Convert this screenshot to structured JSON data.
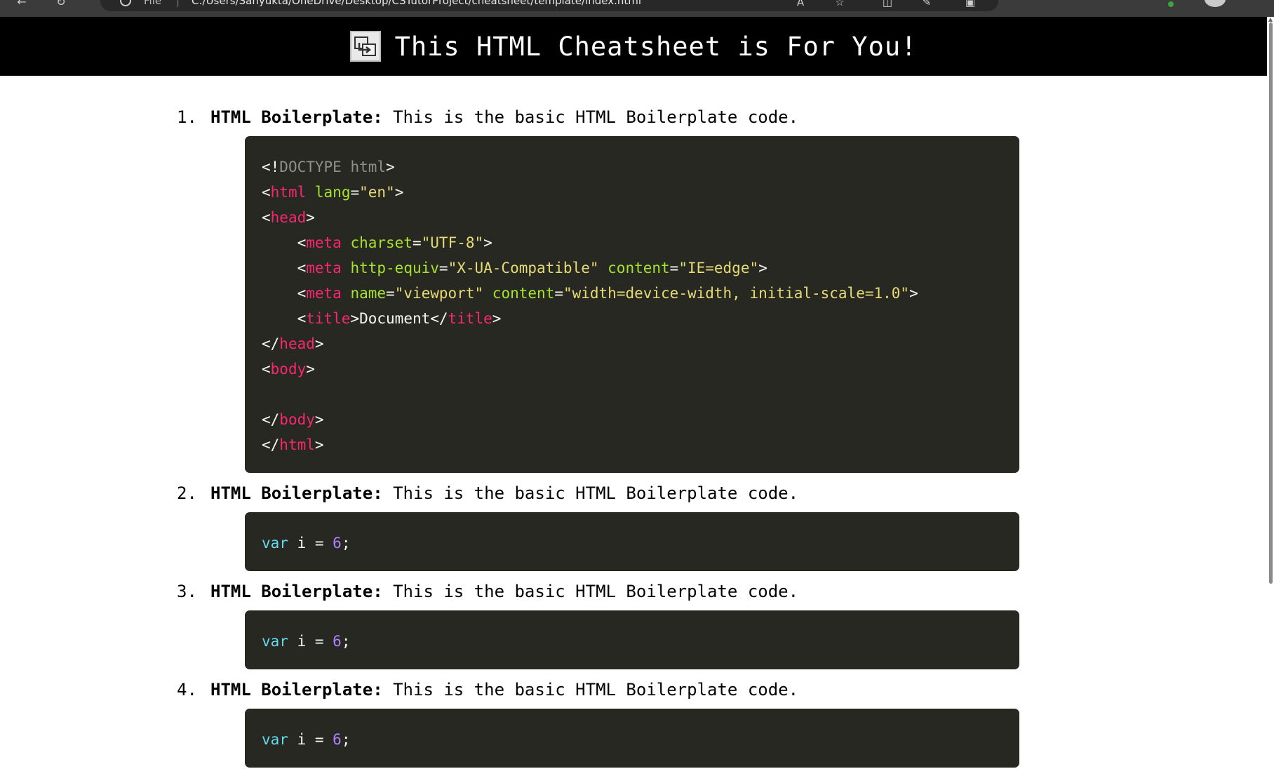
{
  "browser": {
    "url_scheme": "File",
    "url": "C:/Users/Sanyukta/OneDrive/Desktop/CSTutorProject/cheatsheet/template/index.html"
  },
  "header": {
    "title": "This HTML Cheatsheet is For You!",
    "background": "#000000",
    "text_color": "#ffffff"
  },
  "items": [
    {
      "number": "1.",
      "term": "HTML Boilerplate:",
      "description": " This is the basic HTML Boilerplate code.",
      "code_lines": [
        [
          {
            "t": "punc",
            "v": "<!"
          },
          {
            "t": "doctype",
            "v": "DOCTYPE html"
          },
          {
            "t": "punc",
            "v": ">"
          }
        ],
        [
          {
            "t": "punc",
            "v": "<"
          },
          {
            "t": "tag",
            "v": "html"
          },
          {
            "t": "text",
            "v": " "
          },
          {
            "t": "attr",
            "v": "lang"
          },
          {
            "t": "punc",
            "v": "="
          },
          {
            "t": "str",
            "v": "\"en\""
          },
          {
            "t": "punc",
            "v": ">"
          }
        ],
        [
          {
            "t": "punc",
            "v": "<"
          },
          {
            "t": "tag",
            "v": "head"
          },
          {
            "t": "punc",
            "v": ">"
          }
        ],
        [
          {
            "t": "text",
            "v": "    "
          },
          {
            "t": "punc",
            "v": "<"
          },
          {
            "t": "tag",
            "v": "meta"
          },
          {
            "t": "text",
            "v": " "
          },
          {
            "t": "attr",
            "v": "charset"
          },
          {
            "t": "punc",
            "v": "="
          },
          {
            "t": "str",
            "v": "\"UTF-8\""
          },
          {
            "t": "punc",
            "v": ">"
          }
        ],
        [
          {
            "t": "text",
            "v": "    "
          },
          {
            "t": "punc",
            "v": "<"
          },
          {
            "t": "tag",
            "v": "meta"
          },
          {
            "t": "text",
            "v": " "
          },
          {
            "t": "attr",
            "v": "http-equiv"
          },
          {
            "t": "punc",
            "v": "="
          },
          {
            "t": "str",
            "v": "\"X-UA-Compatible\""
          },
          {
            "t": "text",
            "v": " "
          },
          {
            "t": "attr",
            "v": "content"
          },
          {
            "t": "punc",
            "v": "="
          },
          {
            "t": "str",
            "v": "\"IE=edge\""
          },
          {
            "t": "punc",
            "v": ">"
          }
        ],
        [
          {
            "t": "text",
            "v": "    "
          },
          {
            "t": "punc",
            "v": "<"
          },
          {
            "t": "tag",
            "v": "meta"
          },
          {
            "t": "text",
            "v": " "
          },
          {
            "t": "attr",
            "v": "name"
          },
          {
            "t": "punc",
            "v": "="
          },
          {
            "t": "str",
            "v": "\"viewport\""
          },
          {
            "t": "text",
            "v": " "
          },
          {
            "t": "attr",
            "v": "content"
          },
          {
            "t": "punc",
            "v": "="
          },
          {
            "t": "str",
            "v": "\"width=device-width, initial-scale=1.0\""
          },
          {
            "t": "punc",
            "v": ">"
          }
        ],
        [
          {
            "t": "text",
            "v": "    "
          },
          {
            "t": "punc",
            "v": "<"
          },
          {
            "t": "tag",
            "v": "title"
          },
          {
            "t": "punc",
            "v": ">"
          },
          {
            "t": "text",
            "v": "Document"
          },
          {
            "t": "punc",
            "v": "</"
          },
          {
            "t": "tag",
            "v": "title"
          },
          {
            "t": "punc",
            "v": ">"
          }
        ],
        [
          {
            "t": "punc",
            "v": "</"
          },
          {
            "t": "tag",
            "v": "head"
          },
          {
            "t": "punc",
            "v": ">"
          }
        ],
        [
          {
            "t": "punc",
            "v": "<"
          },
          {
            "t": "tag",
            "v": "body"
          },
          {
            "t": "punc",
            "v": ">"
          }
        ],
        [
          {
            "t": "text",
            "v": " "
          }
        ],
        [
          {
            "t": "punc",
            "v": "</"
          },
          {
            "t": "tag",
            "v": "body"
          },
          {
            "t": "punc",
            "v": ">"
          }
        ],
        [
          {
            "t": "punc",
            "v": "</"
          },
          {
            "t": "tag",
            "v": "html"
          },
          {
            "t": "punc",
            "v": ">"
          }
        ]
      ]
    },
    {
      "number": "2.",
      "term": "HTML Boilerplate:",
      "description": " This is the basic HTML Boilerplate code.",
      "code_lines": [
        [
          {
            "t": "kw",
            "v": "var"
          },
          {
            "t": "text",
            "v": " i = "
          },
          {
            "t": "num",
            "v": "6"
          },
          {
            "t": "text",
            "v": ";"
          }
        ]
      ]
    },
    {
      "number": "3.",
      "term": "HTML Boilerplate:",
      "description": " This is the basic HTML Boilerplate code.",
      "code_lines": [
        [
          {
            "t": "kw",
            "v": "var"
          },
          {
            "t": "text",
            "v": " i = "
          },
          {
            "t": "num",
            "v": "6"
          },
          {
            "t": "text",
            "v": ";"
          }
        ]
      ]
    },
    {
      "number": "4.",
      "term": "HTML Boilerplate:",
      "description": " This is the basic HTML Boilerplate code.",
      "code_lines": [
        [
          {
            "t": "kw",
            "v": "var"
          },
          {
            "t": "text",
            "v": " i = "
          },
          {
            "t": "num",
            "v": "6"
          },
          {
            "t": "text",
            "v": ";"
          }
        ]
      ]
    }
  ],
  "code_theme": {
    "background": "#272822",
    "tag": "#f92672",
    "attr": "#a6e22e",
    "string": "#e6db74",
    "keyword": "#66d9ef",
    "number": "#ae81ff",
    "doctype": "#8f908a",
    "text": "#f8f8f2"
  }
}
